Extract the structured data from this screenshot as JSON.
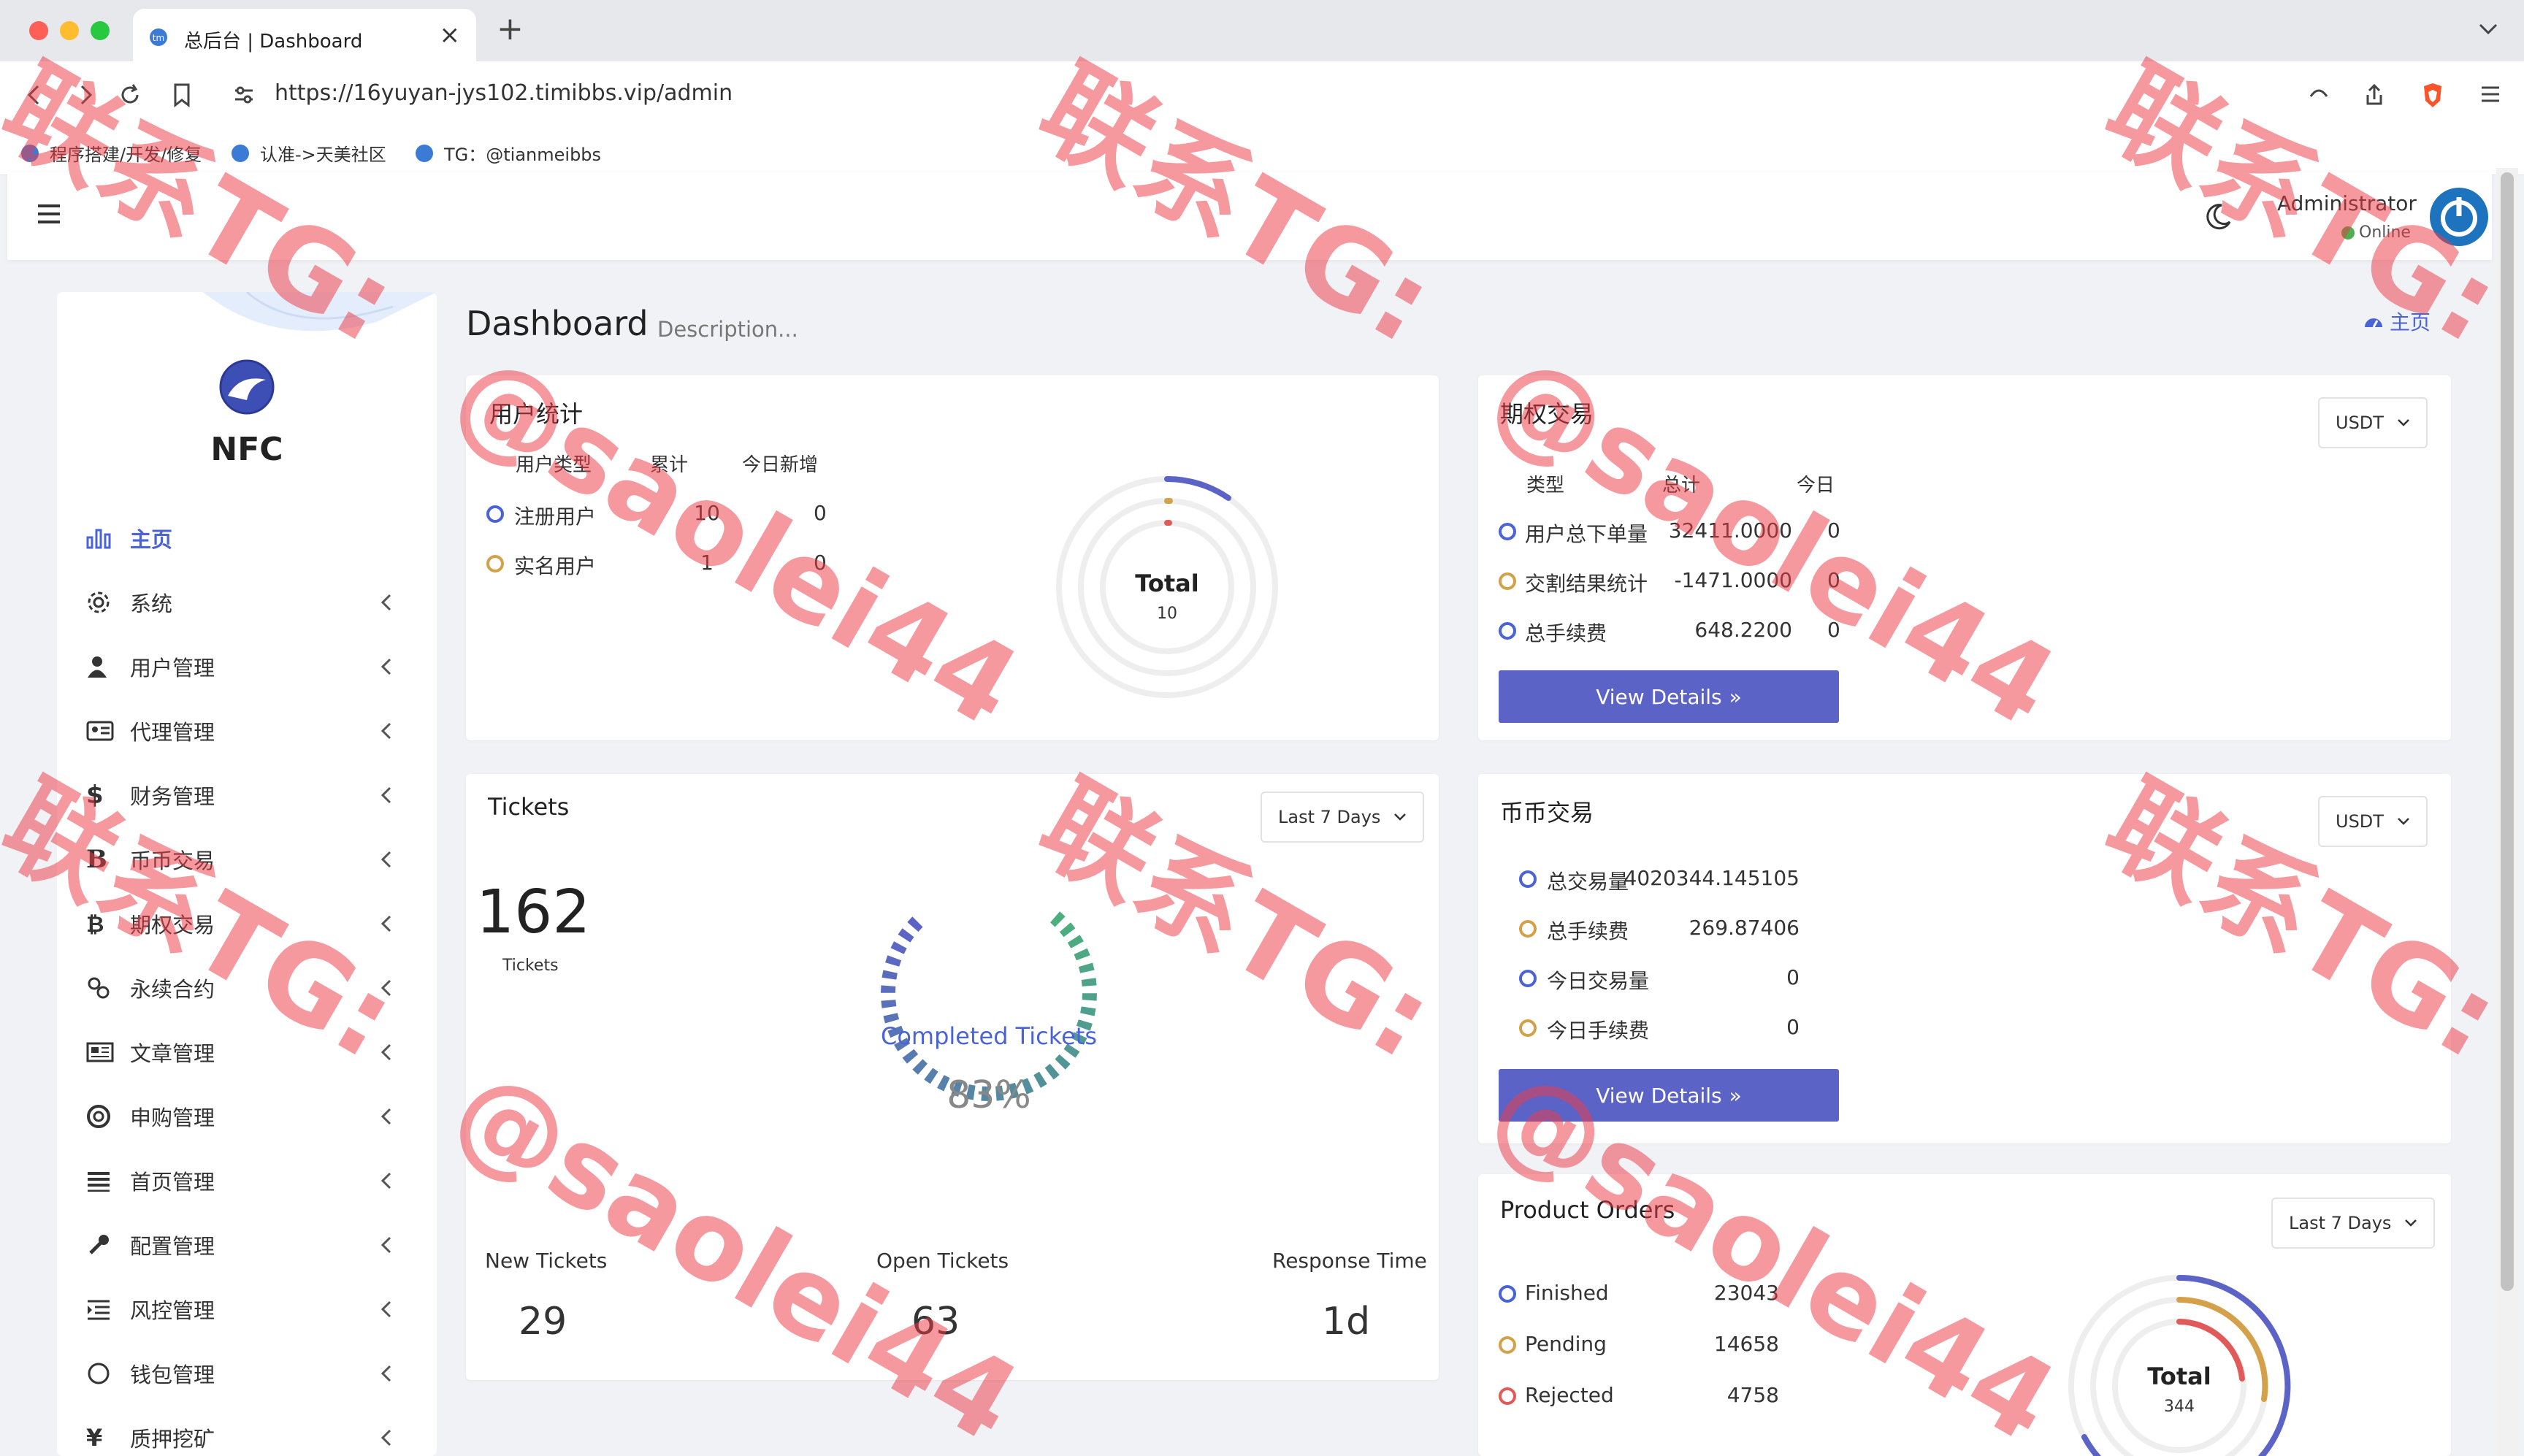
{
  "browser": {
    "tab_title": "总后台 | Dashboard",
    "url": "https://16yuyan-jys102.timibbs.vip/admin",
    "bookmarks": [
      "程序搭建/开发/修复",
      "认准->天美社区",
      "TG：@tianmeibbs"
    ]
  },
  "header": {
    "user_name": "Administrator",
    "user_status": "Online"
  },
  "sidebar": {
    "brand": "NFC",
    "items": [
      {
        "label": "主页",
        "icon": "bar-chart-icon"
      },
      {
        "label": "系统",
        "icon": "gear-icon"
      },
      {
        "label": "用户管理",
        "icon": "user-icon"
      },
      {
        "label": "代理管理",
        "icon": "id-card-icon"
      },
      {
        "label": "财务管理",
        "icon": "dollar-icon"
      },
      {
        "label": "币币交易",
        "icon": "bold-b-icon"
      },
      {
        "label": "期权交易",
        "icon": "bitcoin-icon"
      },
      {
        "label": "永续合约",
        "icon": "link-icon"
      },
      {
        "label": "文章管理",
        "icon": "newspaper-icon"
      },
      {
        "label": "申购管理",
        "icon": "lifebuoy-icon"
      },
      {
        "label": "首页管理",
        "icon": "list-icon"
      },
      {
        "label": "配置管理",
        "icon": "wrench-icon"
      },
      {
        "label": "风控管理",
        "icon": "indent-icon"
      },
      {
        "label": "钱包管理",
        "icon": "circle-icon"
      },
      {
        "label": "质押挖矿",
        "icon": "yen-icon"
      }
    ]
  },
  "page": {
    "title": "Dashboard",
    "description": "Description...",
    "home_link": "主页"
  },
  "user_stats": {
    "title": "用户统计",
    "headers": [
      "用户类型",
      "累计",
      "今日新增"
    ],
    "rows": [
      {
        "label": "注册用户",
        "total": "10",
        "today": "0",
        "color": "#4a63d6"
      },
      {
        "label": "实名用户",
        "total": "1",
        "today": "0",
        "color": "#d4a14a"
      }
    ],
    "donut_label": "Total",
    "donut_value": "10"
  },
  "options_trading": {
    "title": "期权交易",
    "currency": "USDT",
    "headers": [
      "类型",
      "总计",
      "今日"
    ],
    "rows": [
      {
        "label": "用户总下单量",
        "total": "32411.0000",
        "today": "0",
        "color": "#4a63d6"
      },
      {
        "label": "交割结果统计",
        "total": "-1471.0000",
        "today": "0",
        "color": "#d4a14a"
      },
      {
        "label": "总手续费",
        "total": "648.2200",
        "today": "0",
        "color": "#4a63d6"
      }
    ],
    "button": "View Details"
  },
  "tickets": {
    "title": "Tickets",
    "range": "Last 7 Days",
    "count": "162",
    "count_label": "Tickets",
    "gauge_label": "Completed Tickets",
    "gauge_value": "83%",
    "gauge_fraction": 0.83,
    "stats": [
      {
        "label": "New Tickets",
        "value": "29"
      },
      {
        "label": "Open Tickets",
        "value": "63"
      },
      {
        "label": "Response Time",
        "value": "1d"
      }
    ]
  },
  "coin_trading": {
    "title": "币币交易",
    "currency": "USDT",
    "rows": [
      {
        "label": "总交易量",
        "value": "4020344.145105",
        "color": "#4a63d6"
      },
      {
        "label": "总手续费",
        "value": "269.87406",
        "color": "#d4a14a"
      },
      {
        "label": "今日交易量",
        "value": "0",
        "color": "#4a63d6"
      },
      {
        "label": "今日手续费",
        "value": "0",
        "color": "#d4a14a"
      }
    ],
    "button": "View Details"
  },
  "product_orders": {
    "title": "Product Orders",
    "range": "Last 7 Days",
    "rows": [
      {
        "label": "Finished",
        "value": "23043",
        "color": "#4a63d6"
      },
      {
        "label": "Pending",
        "value": "14658",
        "color": "#d4a14a"
      },
      {
        "label": "Rejected",
        "value": "4758",
        "color": "#e05a5a"
      }
    ],
    "donut_label": "Total",
    "donut_value": "344"
  },
  "watermark": {
    "line1": "联系TG:",
    "line2": "@saolei44"
  },
  "colors": {
    "accent": "#4a63d6",
    "button": "#5c63c7",
    "gold": "#d4a14a",
    "red": "#e05a5a",
    "green": "#4caf7d",
    "watermark": "#ec3c46"
  }
}
